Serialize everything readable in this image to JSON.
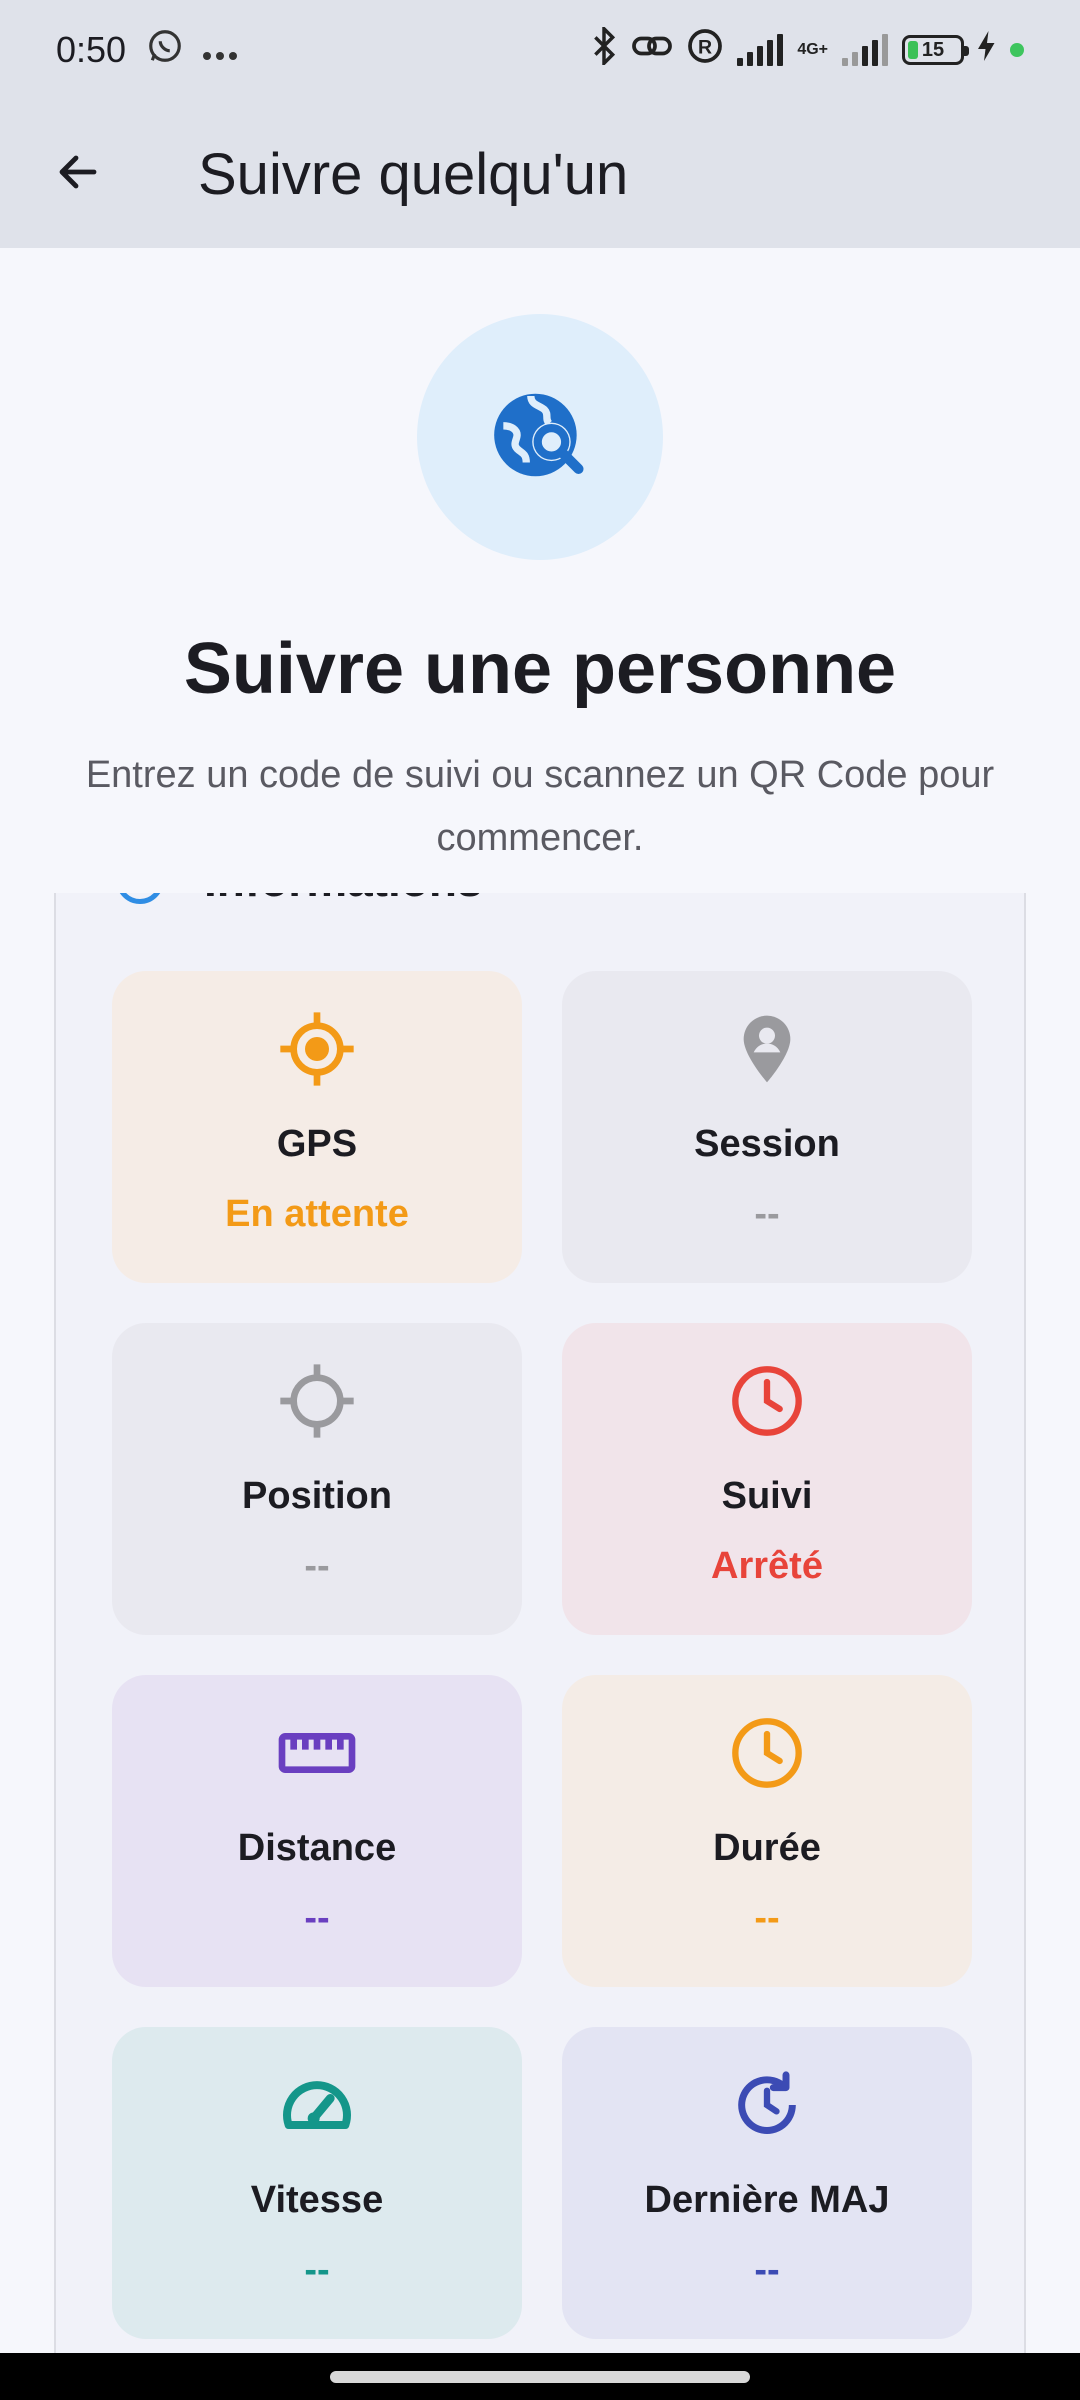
{
  "status": {
    "time": "0:50",
    "network": "4G+",
    "battery": "15",
    "colors": {
      "battery_fill": "#3cc158",
      "dot": "#3ec55e"
    }
  },
  "appbar": {
    "title": "Suivre quelqu'un",
    "back_icon": "arrow-left-icon"
  },
  "hero": {
    "icon": "travel-explore-icon",
    "title": "Suivre une personne",
    "subtitle": "Entrez un code de suivi ou scannez un QR Code pour commencer."
  },
  "info": {
    "title": "Informations",
    "tiles": [
      {
        "label": "GPS",
        "value": "En attente",
        "icon": "gps-fixed-icon",
        "accent": "#f39a17",
        "bg": "#f5ece6"
      },
      {
        "label": "Session",
        "value": "--",
        "icon": "person-pin-icon",
        "accent": "#9a9a9e",
        "bg": "#e9e9f0"
      },
      {
        "label": "Position",
        "value": "--",
        "icon": "gps-crosshair-icon",
        "accent": "#9a9a9e",
        "bg": "#e9e9f0"
      },
      {
        "label": "Suivi",
        "value": "Arrêté",
        "icon": "clock-icon",
        "accent": "#e8443a",
        "bg": "#f1e4ea"
      },
      {
        "label": "Distance",
        "value": "--",
        "icon": "ruler-icon",
        "accent": "#6a3fc0",
        "bg": "#e7e2f3"
      },
      {
        "label": "Durée",
        "value": "--",
        "icon": "clock-icon",
        "accent": "#f39a17",
        "bg": "#f4ece6"
      },
      {
        "label": "Vitesse",
        "value": "--",
        "icon": "speedometer-icon",
        "accent": "#14968a",
        "bg": "#ddeaee"
      },
      {
        "label": "Dernière MAJ",
        "value": "--",
        "icon": "update-icon",
        "accent": "#3c4bb4",
        "bg": "#e3e4f3"
      }
    ]
  }
}
